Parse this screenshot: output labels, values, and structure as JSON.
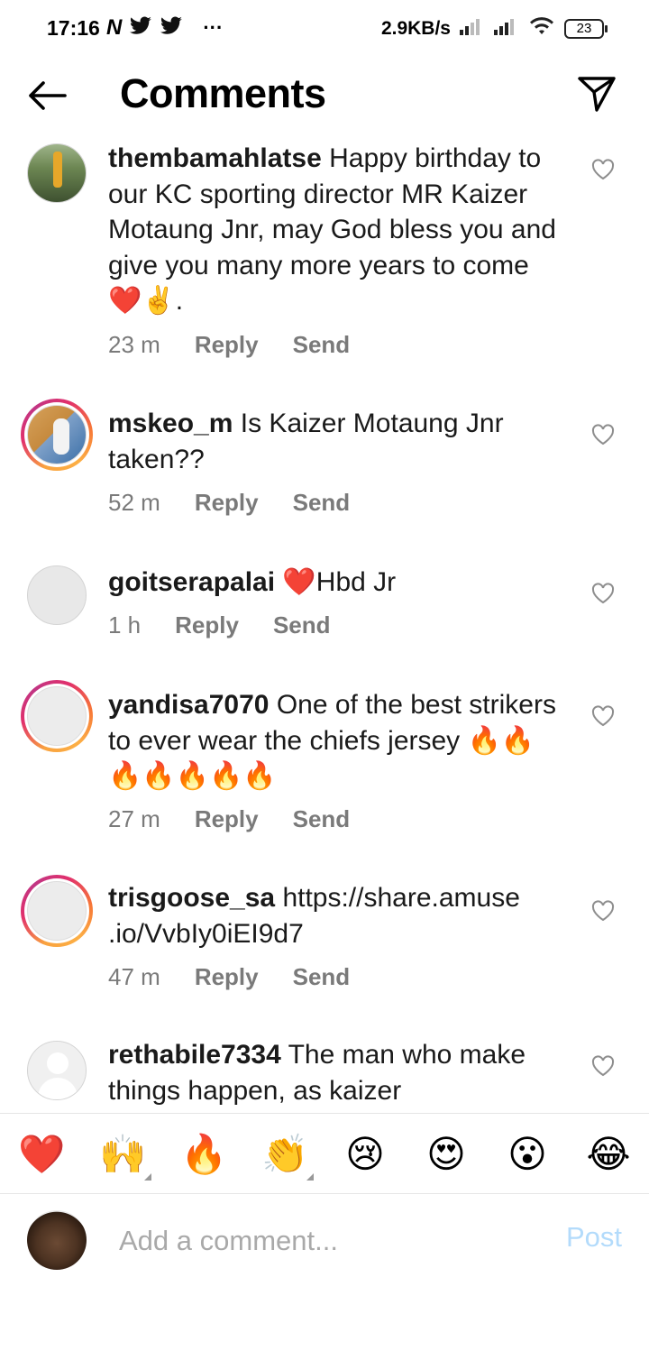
{
  "status_bar": {
    "time": "17:16",
    "net_speed": "2.9KB/s",
    "battery": "23",
    "more": "···"
  },
  "header": {
    "title": "Comments"
  },
  "comments": [
    {
      "username": "thembamahlatse",
      "text": "Happy birthday to our KC sporting director MR Kaizer Motaung Jnr, may God bless you and give you many more years to come ❤️✌️.",
      "time": "23 m",
      "reply": "Reply",
      "send": "Send"
    },
    {
      "username": "mskeo_m",
      "text": "Is Kaizer Motaung Jnr taken??",
      "time": "52 m",
      "reply": "Reply",
      "send": "Send"
    },
    {
      "username": "goitserapalai",
      "text": "❤️Hbd Jr",
      "time": "1 h",
      "reply": "Reply",
      "send": "Send"
    },
    {
      "username": "yandisa7070",
      "text": "One of the best strikers to ever wear the chiefs jersey 🔥🔥🔥🔥🔥🔥🔥",
      "time": "27 m",
      "reply": "Reply",
      "send": "Send"
    },
    {
      "username": "trisgoose_sa",
      "text": "https://share.amuse .io/VvbIy0iEI9d7",
      "time": "47 m",
      "reply": "Reply",
      "send": "Send"
    },
    {
      "username": "rethabile7334",
      "text": "The man who make things happen, as kaizer"
    }
  ],
  "emoji_bar": {
    "emojis": [
      "❤️",
      "🙌",
      "🔥",
      "👏",
      "😢",
      "😍",
      "😮",
      "😂"
    ]
  },
  "composer": {
    "placeholder": "Add a comment...",
    "post_label": "Post"
  },
  "colors": {
    "meta_text": "#7a7a7a",
    "post_disabled": "#b3dbfb",
    "heart_red": "#e0202a"
  }
}
